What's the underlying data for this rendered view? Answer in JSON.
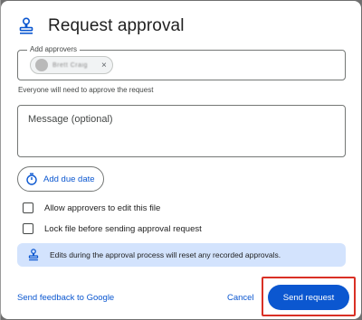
{
  "dialog": {
    "title": "Request approval",
    "approvers": {
      "label": "Add approvers",
      "chip_name": "Brett Craig",
      "chip_remove_glyph": "×"
    },
    "helper_text": "Everyone will need to approve the request",
    "message": {
      "placeholder": "Message (optional)",
      "value": ""
    },
    "due_date_button": "Add due date",
    "checkboxes": [
      {
        "label": "Allow approvers to edit this file",
        "checked": false
      },
      {
        "label": "Lock file before sending approval request",
        "checked": false
      }
    ],
    "info_banner": "Edits during the approval process will reset any recorded approvals.",
    "footer": {
      "feedback_link": "Send feedback to Google",
      "cancel": "Cancel",
      "send": "Send request"
    }
  },
  "icons": {
    "title": "approval-stamp-icon",
    "due_date": "timer-icon",
    "banner": "approval-stamp-icon"
  },
  "colors": {
    "accent": "#0b57d0",
    "banner_bg": "#d3e3fd",
    "highlight": "#d93025"
  }
}
